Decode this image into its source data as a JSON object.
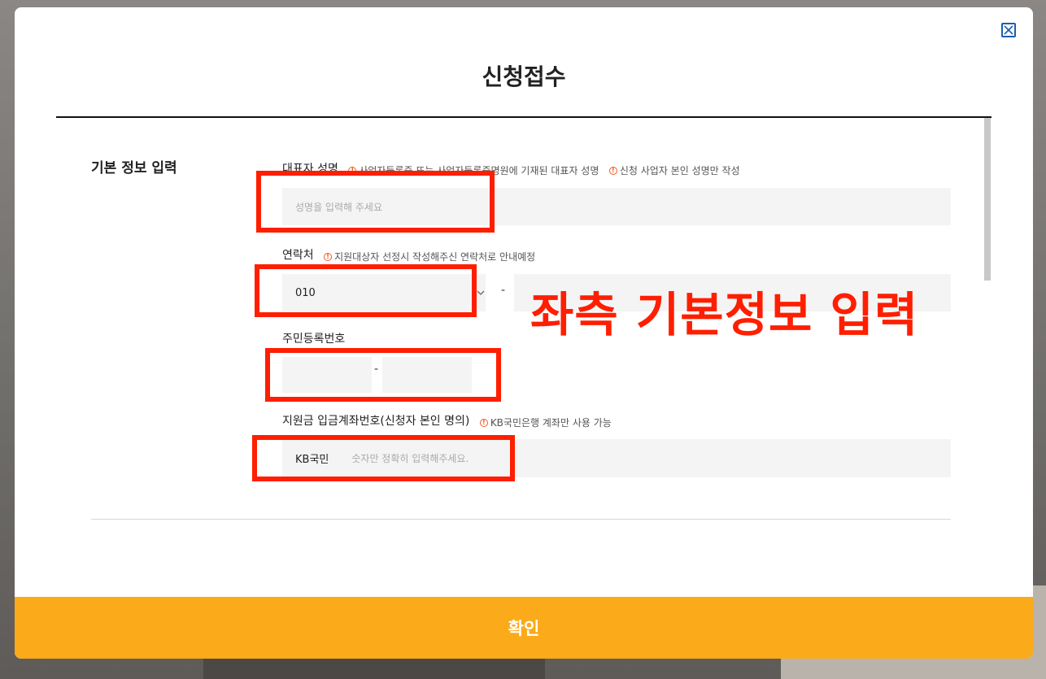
{
  "modal": {
    "title": "신청접수",
    "close_icon": "close-icon",
    "section_label": "기본 정보 입력",
    "confirm_label": "확인"
  },
  "fields": {
    "name": {
      "label": "대표자 성명",
      "hint1": "사업자등록증 또는 사업자등록증명원에 기재된 대표자 성명",
      "hint2": "신청 사업자 본인 성명만 작성",
      "placeholder": "성명을 입력해 주세요"
    },
    "contact": {
      "label": "연락처",
      "hint": "지원대상자 선정시 작성해주신 연락처로 안내예정",
      "prefix_value": "010",
      "separator": "-"
    },
    "rrn": {
      "label": "주민등록번호",
      "separator": "-"
    },
    "account": {
      "label": "지원금 입금계좌번호(신청자 본인 명의)",
      "hint": "KB국민은행 계좌만 사용 가능",
      "bank": "KB국민",
      "placeholder": "숫자만 정확히 입력해주세요."
    }
  },
  "annotation": {
    "text": "좌측 기본정보 입력",
    "color": "#ff1e00"
  },
  "colors": {
    "accent": "#fbaa1a",
    "hint_icon": "#f15a24",
    "close_icon": "#1d5fa8"
  }
}
